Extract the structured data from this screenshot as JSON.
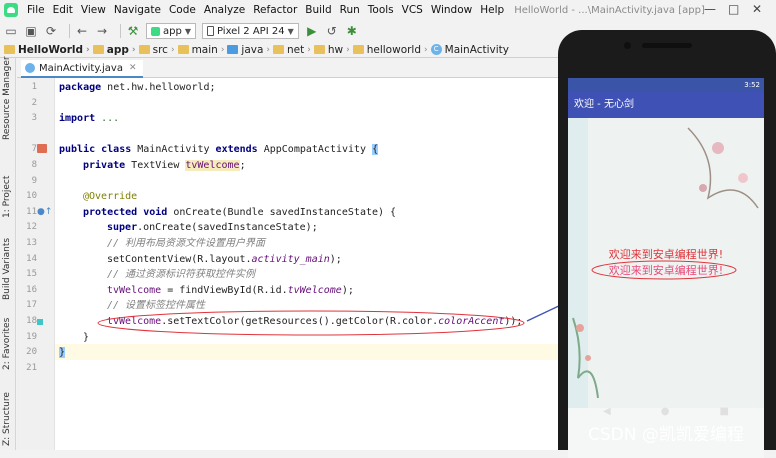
{
  "menubar": {
    "items": [
      "File",
      "Edit",
      "View",
      "Navigate",
      "Code",
      "Analyze",
      "Refactor",
      "Build",
      "Run",
      "Tools",
      "VCS",
      "Window",
      "Help"
    ],
    "window_title": "HelloWorld - ...\\MainActivity.java [app]"
  },
  "toolbar": {
    "module": "app",
    "device": "Pixel 2 API 24"
  },
  "breadcrumb": [
    "HelloWorld",
    "app",
    "src",
    "main",
    "java",
    "net",
    "hw",
    "helloworld",
    "MainActivity"
  ],
  "side_tools": [
    "Resource Manager",
    "1: Project",
    "Build Variants",
    "2: Favorites",
    "Z: Structure"
  ],
  "editor": {
    "tab_label": "MainActivity.java",
    "line_numbers": [
      "1",
      "2",
      "3",
      "7",
      "8",
      "9",
      "10",
      "11",
      "12",
      "13",
      "14",
      "15",
      "16",
      "17",
      "18",
      "19",
      "20",
      "21"
    ],
    "code": {
      "l1_kw": "package",
      "l1_rest": " net.hw.helloworld;",
      "l3_kw": "import",
      "l3_rest": " ...",
      "l8_a": "public class",
      "l8_b": " MainActivity ",
      "l8_c": "extends",
      "l8_d": " AppCompatActivity ",
      "l8_e": "{",
      "l9_kw": "private",
      "l9_type": " TextView ",
      "l9_var": "tvWelcome",
      "l9_end": ";",
      "l11": "@Override",
      "l12_kw": "protected void",
      "l12_rest": " onCreate(Bundle savedInstanceState) {",
      "l13_kw": "super",
      "l13_rest": ".onCreate(savedInstanceState);",
      "l14": "// 利用布局资源文件设置用户界面",
      "l15_a": "setContentView(R.layout.",
      "l15_b": "activity_main",
      "l15_c": ");",
      "l16": "// 通过资源标识符获取控件实例",
      "l17_a": "tvWelcome",
      "l17_b": " = findViewById(R.id.",
      "l17_c": "tvWelcome",
      "l17_d": ");",
      "l18": "// 设置标签控件属性",
      "l19_a": "tvWelcome",
      "l19_b": ".setTextColor(getResources().getColor(R.color.",
      "l19_c": "colorAccent",
      "l19_d": "));",
      "l20": "}",
      "l21": "}"
    }
  },
  "emulator": {
    "status_time": "3:52",
    "app_title": "欢迎 - 无心剑",
    "text_default": "欢迎来到安卓编程世界!",
    "text_accent": "欢迎来到安卓编程世界!"
  },
  "colors": {
    "app_bar": "#3f51b5",
    "status_bar": "#3a54a8",
    "accent": "#e84a7a",
    "annotation": "#e0333a"
  },
  "watermark": "CSDN @凯凯爱编程"
}
